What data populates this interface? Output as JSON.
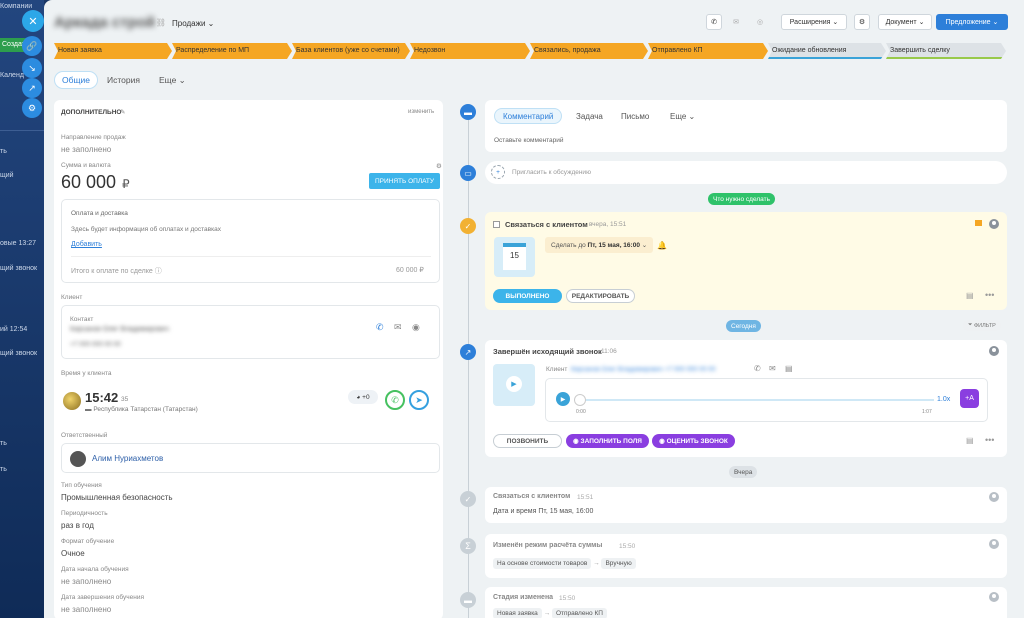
{
  "background_app": {
    "top_label": "Компании",
    "create_label": "Создать",
    "calendar_label": "Календ",
    "items": [
      "ть",
      "щий",
      "овые 13:27",
      "щий звонок",
      "ий 12:54",
      "щий звонок",
      "ть",
      "ть"
    ]
  },
  "header": {
    "title": "Аркада строй",
    "category": "Продажи",
    "extensions_label": "Расширения",
    "document_label": "Документ",
    "offer_label": "Предложение"
  },
  "stages": [
    {
      "label": "Новая заявка",
      "state": "done"
    },
    {
      "label": "Распределение по МП",
      "state": "done"
    },
    {
      "label": "База клиентов (уже со счетами)",
      "state": "done"
    },
    {
      "label": "Недозвон",
      "state": "done"
    },
    {
      "label": "Связались, продажа",
      "state": "done"
    },
    {
      "label": "Отправлено КП",
      "state": "done"
    },
    {
      "label": "Ожидание обновления",
      "state": "pending"
    },
    {
      "label": "Завершить сделку",
      "state": "final"
    }
  ],
  "tabs": {
    "general": "Общие",
    "history": "История",
    "more": "Еще"
  },
  "left": {
    "section_title": "ДОПОЛНИТЕЛЬНО",
    "change_label": "изменить",
    "direction_label": "Направление продаж",
    "not_filled": "не заполнено",
    "sum_label": "Сумма и валюта",
    "amount": "60 000",
    "currency": "₽",
    "accept_payment": "ПРИНЯТЬ ОПЛАТУ",
    "payment_title": "Оплата и доставка",
    "payment_info": "Здесь будет информация об оплатах и доставках",
    "add_label": "Добавить",
    "total_label": "Итого к оплате по сделке",
    "total_value": "60 000 ₽",
    "client_label": "Клиент",
    "contact_label": "Контакт",
    "contact_name": "Кирсанов Олег Владимирович",
    "contact_phone": "+7 000 000 00 00",
    "client_time_label": "Время у клиента",
    "client_time": "15:42",
    "client_seconds": "35",
    "client_region": "Республика Татарстан (Татарстан)",
    "plus_count": "+0",
    "responsible_label": "Ответственный",
    "responsible_name": "Алим Нуриахметов",
    "training_type_label": "Тип обучения",
    "training_type": "Промышленная безопасность",
    "periodicity_label": "Периодичность",
    "periodicity": "раз в год",
    "format_label": "Формат обучение",
    "format": "Очное",
    "start_label": "Дата начала обучения",
    "end_label": "Дата завершения обучения"
  },
  "composer": {
    "tabs": [
      "Комментарий",
      "Задача",
      "Письмо",
      "Еще"
    ],
    "placeholder": "Оставьте комментарий",
    "invite": "Пригласить к обсуждению"
  },
  "todo_badge": "Что нужно сделать",
  "task": {
    "title": "Связаться с клиентом",
    "time": "вчера, 15:51",
    "calendar_day": "15",
    "deadline_prefix": "Сделать до",
    "deadline": "Пт, 15 мая, 16:00",
    "done_label": "ВЫПОЛНЕНО",
    "edit_label": "РЕДАКТИРОВАТЬ"
  },
  "today_label": "Сегодня",
  "filter_label": "ФИЛЬТР",
  "call": {
    "title": "Завершён исходящий звонок",
    "time": "11:06",
    "client_label": "Клиент",
    "client_value": "Кирсанов Олег Владимирович +7 000 000 00 00",
    "start": "0:00",
    "end": "1:07",
    "speed": "1.0x",
    "ai_label": "+A",
    "call_btn": "ПОЗВОНИТЬ",
    "fill_btn": "ЗАПОЛНИТЬ ПОЛЯ",
    "rate_btn": "ОЦЕНИТЬ ЗВОНОК"
  },
  "yesterday_label": "Вчера",
  "history": [
    {
      "title": "Связаться с клиентом",
      "time": "15:51",
      "detail": "Дата и время Пт, 15 мая, 16:00"
    },
    {
      "title": "Изменён режим расчёта суммы",
      "time": "15:50",
      "from": "На основе стоимости товаров",
      "to": "Вручную"
    },
    {
      "title": "Стадия изменена",
      "time": "15:50",
      "from": "Новая заявка",
      "to": "Отправлено КП"
    }
  ],
  "colors": {
    "accent": "#2d7fd9",
    "stage_done": "#f5a623",
    "success": "#2fc26a",
    "purple": "#8a3ee0"
  }
}
